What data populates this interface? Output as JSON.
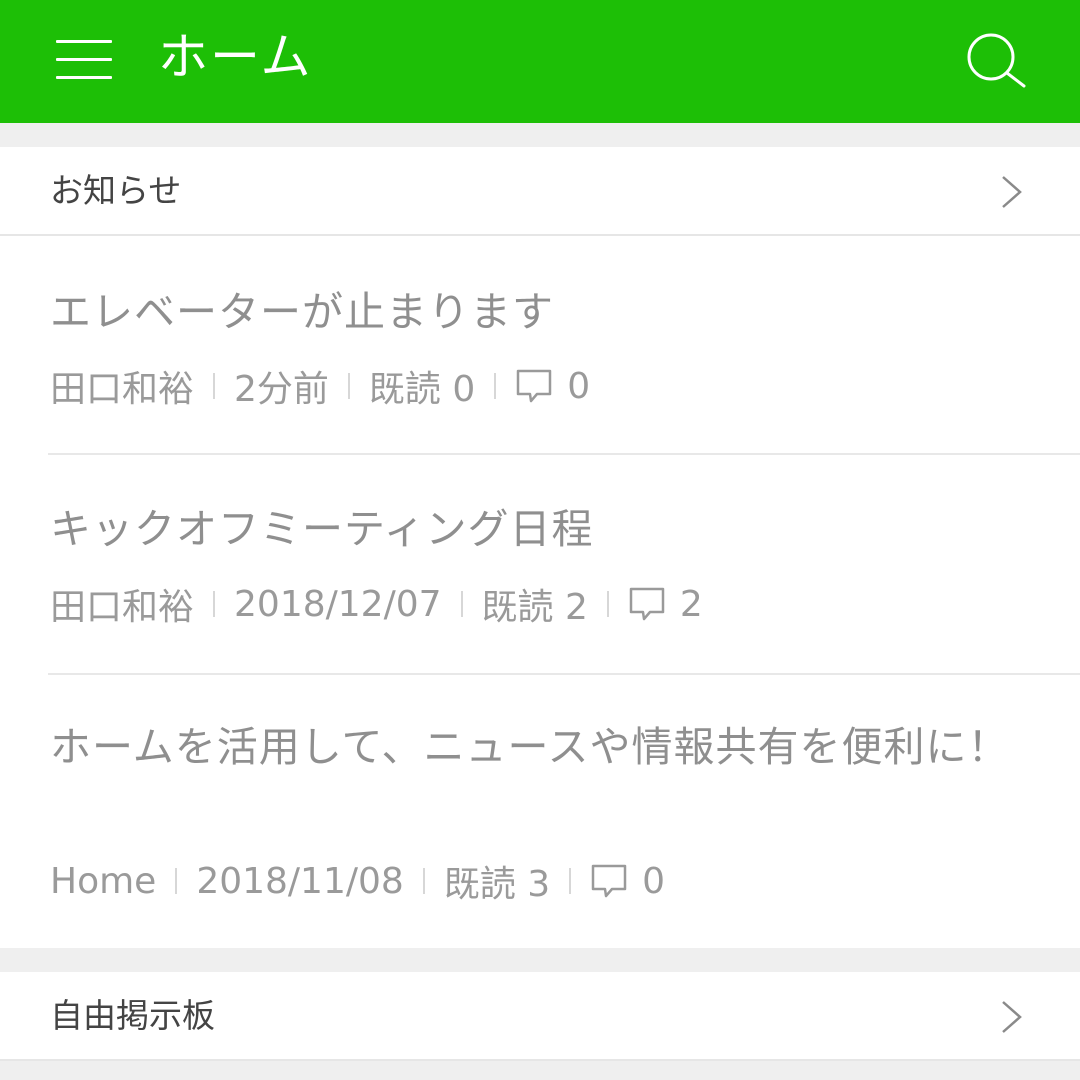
{
  "header": {
    "title": "ホーム",
    "menu_icon": "hamburger-icon",
    "search_icon": "search-icon",
    "accent_color": "#1dbf06"
  },
  "sections": {
    "announcements": {
      "title": "お知らせ"
    },
    "board": {
      "title": "自由掲示板"
    }
  },
  "posts": [
    {
      "title": "エレベーターが止まります",
      "author": "田口和裕",
      "date": "2分前",
      "read": "既読 0",
      "comments": "0"
    },
    {
      "title": "キックオフミーティング日程",
      "author": "田口和裕",
      "date": "2018/12/07",
      "read": "既読 2",
      "comments": "2"
    },
    {
      "title": "ホームを活用して、ニュースや情報共有を便利に！",
      "author": "Home",
      "date": "2018/11/08",
      "read": "既読 3",
      "comments": "0"
    }
  ]
}
